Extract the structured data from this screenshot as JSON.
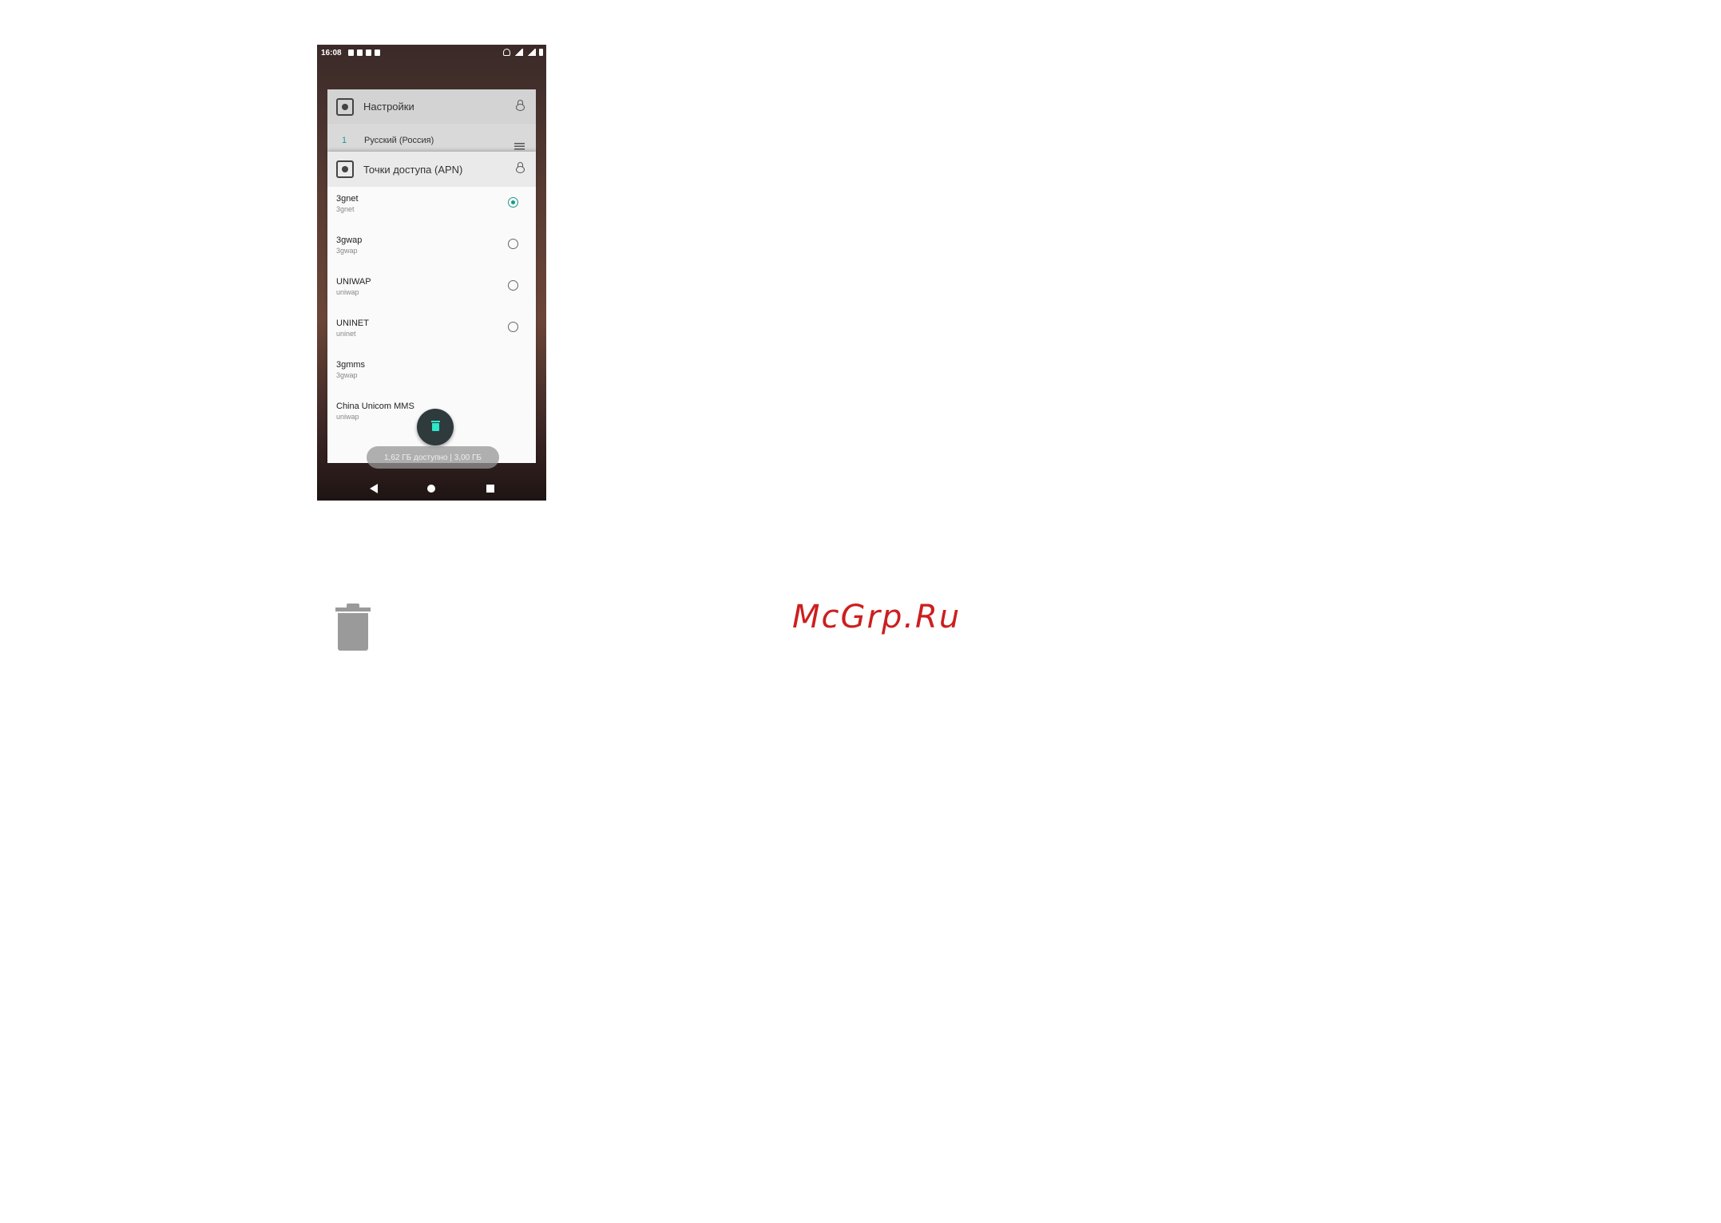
{
  "status_bar": {
    "time": "16:08"
  },
  "settings_card": {
    "title": "Настройки",
    "row": {
      "number": "1",
      "label": "Русский (Россия)"
    }
  },
  "apn_card": {
    "title": "Точки доступа (APN)",
    "items": [
      {
        "name": "3gnet",
        "sub": "3gnet",
        "radio": "checked"
      },
      {
        "name": "3gwap",
        "sub": "3gwap",
        "radio": "unchecked"
      },
      {
        "name": "UNIWAP",
        "sub": "uniwap",
        "radio": "unchecked"
      },
      {
        "name": "UNINET",
        "sub": "uninet",
        "radio": "unchecked"
      },
      {
        "name": "3gmms",
        "sub": "3gwap",
        "radio": "none"
      },
      {
        "name": "China Unicom MMS",
        "sub": "uniwap",
        "radio": "none"
      }
    ]
  },
  "memory_pill": "1,62 ГБ доступно | 3,00 ГБ",
  "watermark": "McGrp.Ru",
  "colors": {
    "accent": "#1a9a8a",
    "fab_icon": "#2ee6c8",
    "watermark": "#cc1f1f"
  },
  "icons": [
    "app-icon",
    "lock-icon",
    "drag-handle-icon",
    "trash-icon",
    "back-icon",
    "home-icon",
    "recents-icon"
  ]
}
